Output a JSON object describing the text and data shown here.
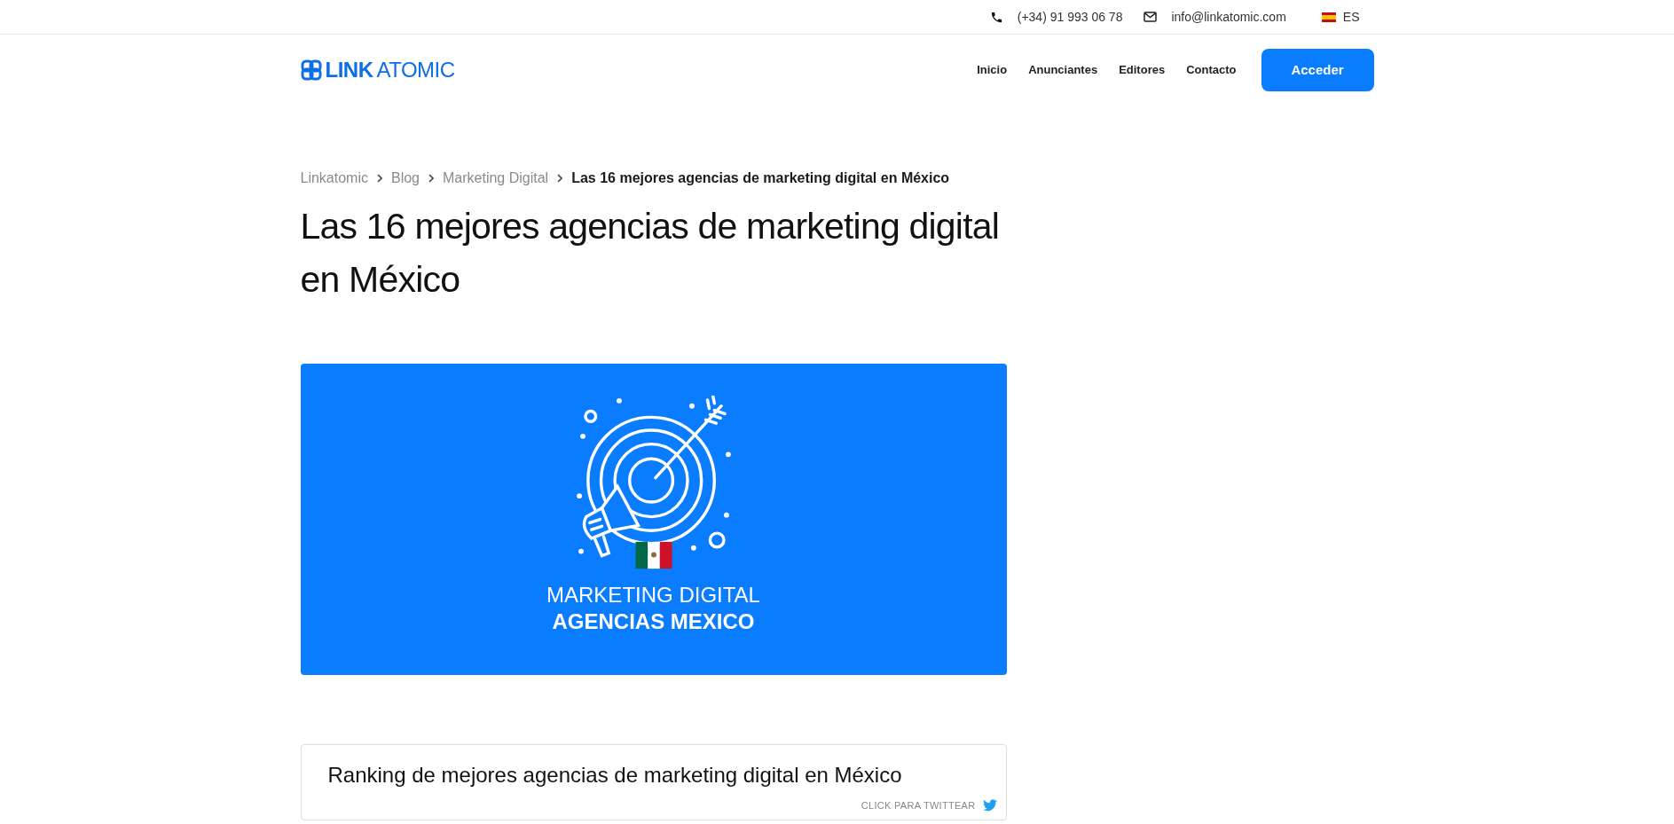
{
  "topbar": {
    "phone": "(+34) 91 993 06 78",
    "email": "info@linkatomic.com",
    "language": "ES"
  },
  "navbar": {
    "logo": {
      "strong": "LINK",
      "light": "ATOMIC"
    },
    "links": [
      "Inicio",
      "Anunciantes",
      "Editores",
      "Contacto"
    ],
    "cta": "Acceder"
  },
  "breadcrumb": [
    {
      "label": "Linkatomic",
      "current": false
    },
    {
      "label": "Blog",
      "current": false
    },
    {
      "label": "Marketing Digital",
      "current": false
    },
    {
      "label": "Las 16 mejores agencias de marketing digital en México",
      "current": true
    }
  ],
  "title": "Las 16 mejores agencias de marketing digital en México",
  "banner": {
    "lines": [
      {
        "text": "MARKETING DIGITAL",
        "bold": false
      },
      {
        "text": "AGENCIAS MEXICO",
        "bold": true
      }
    ]
  },
  "tweet_box": {
    "quote": "Ranking de mejores agencias de marketing digital en México",
    "action": "CLICK PARA TWITTEAR"
  }
}
